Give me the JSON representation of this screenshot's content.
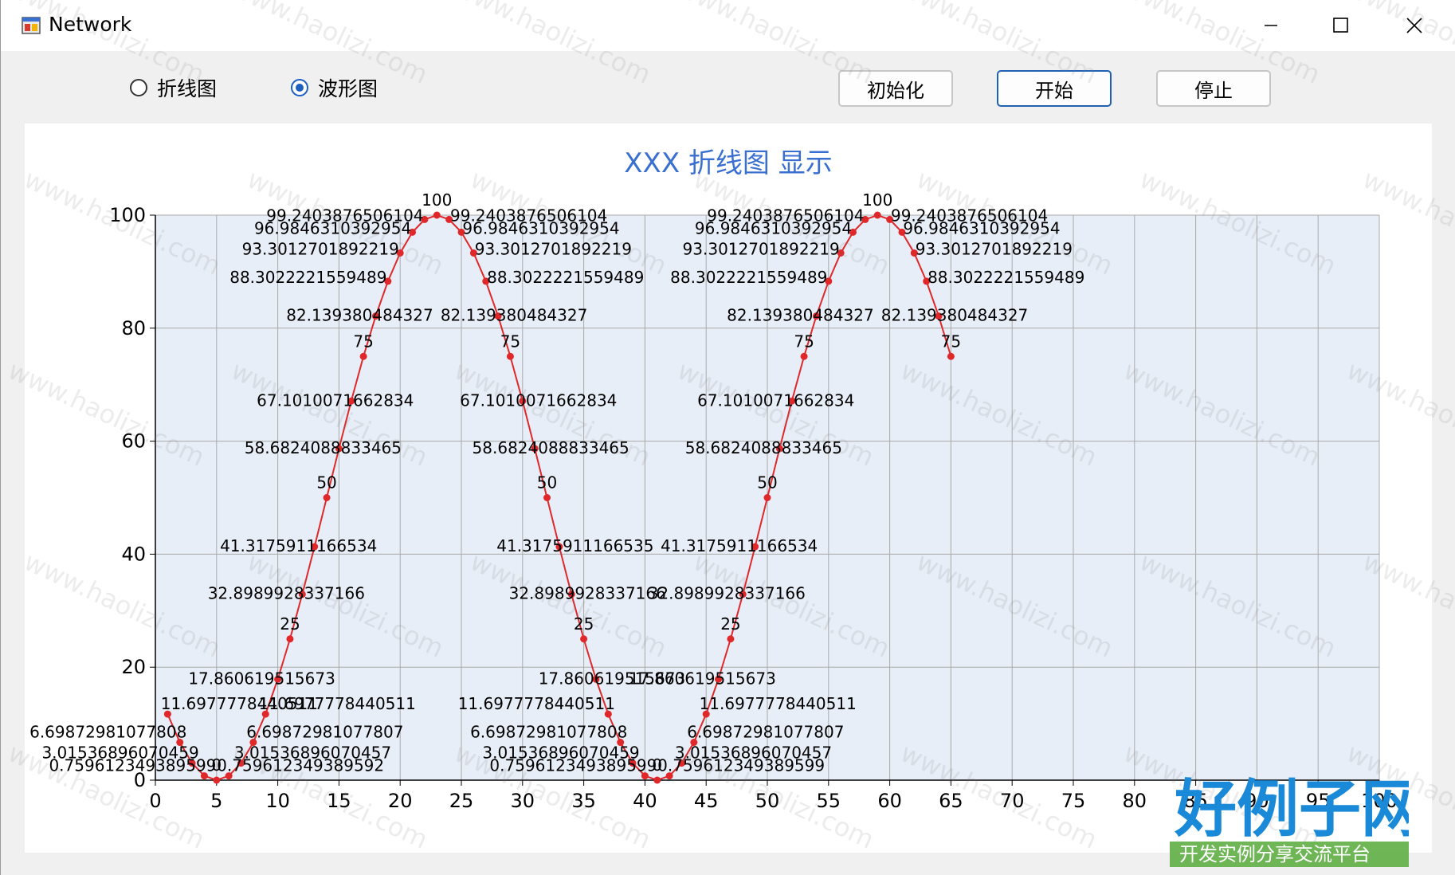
{
  "window": {
    "title": "Network",
    "controls": [
      "minimize-icon",
      "maximize-icon",
      "close-icon"
    ]
  },
  "options": [
    {
      "label": "折线图",
      "selected": false
    },
    {
      "label": "波形图",
      "selected": true
    }
  ],
  "buttons": {
    "init": "初始化",
    "start": "开始",
    "stop": "停止"
  },
  "chart_title": "XXX 折线图 显示",
  "chart_data": {
    "type": "line",
    "title": "XXX 折线图 显示",
    "xlabel": "",
    "ylabel": "",
    "xlim": [
      0,
      100
    ],
    "ylim": [
      0,
      100
    ],
    "x_ticks": [
      "0",
      "5",
      "10",
      "15",
      "20",
      "25",
      "30",
      "35",
      "40",
      "45",
      "50",
      "55",
      "60",
      "65",
      "70",
      "75",
      "80",
      "85",
      "90",
      "95",
      "100"
    ],
    "y_ticks": [
      "0",
      "20",
      "40",
      "60",
      "80",
      "100"
    ],
    "grid": true,
    "series": [
      {
        "color": "#e0282a",
        "x": [
          1,
          2,
          3,
          4,
          5,
          6,
          7,
          8,
          9,
          10,
          11,
          12,
          13,
          14,
          15,
          16,
          17,
          18,
          19,
          20,
          21,
          22,
          23,
          24,
          25,
          26,
          27,
          28,
          29,
          30,
          31,
          32,
          33,
          34,
          35,
          36,
          37,
          38,
          39,
          40,
          41,
          42,
          43,
          44,
          45,
          46,
          47,
          48,
          49,
          50,
          51,
          52,
          53,
          54,
          55,
          56,
          57,
          58,
          59,
          60,
          61,
          62,
          63,
          64,
          65
        ],
        "y": [
          11.6977778440511,
          6.69872981077808,
          3.01536896070459,
          0.759612349389599,
          0,
          0.759612349389592,
          3.01536896070457,
          6.69872981077807,
          11.6977778440511,
          17.860619515673,
          25,
          32.8989928337166,
          41.3175911166534,
          50,
          58.6824088833465,
          67.1010071662834,
          75,
          82.139380484327,
          88.3022221559489,
          93.3012701892219,
          96.9846310392954,
          99.2403876506104,
          100,
          99.2403876506104,
          96.9846310392954,
          93.3012701892219,
          88.3022221559489,
          82.139380484327,
          75,
          67.1010071662834,
          58.6824088833465,
          50,
          41.3175911166535,
          32.8989928337166,
          25,
          17.860619515673,
          11.6977778440511,
          6.69872981077808,
          3.01536896070459,
          0.759612349389599,
          0,
          0.759612349389599,
          3.01536896070457,
          6.69872981077807,
          11.6977778440511,
          17.860619515673,
          25,
          32.8989928337166,
          41.3175911166534,
          50,
          58.6824088833465,
          67.1010071662834,
          75,
          82.139380484327,
          88.3022221559489,
          93.3012701892219,
          96.9846310392954,
          99.2403876506104,
          100,
          99.2403876506104,
          96.9846310392954,
          93.3012701892219,
          88.3022221559489,
          82.139380484327,
          75
        ],
        "labels": [
          "11.6977778440511",
          "6.69872981077808",
          "3.01536896070459",
          "0.759612349389599",
          "0",
          "0.759612349389592",
          "3.01536896070457",
          "6.69872981077807",
          "11.6977778440511",
          "17.860619515673",
          "25",
          "32.8989928337166",
          "41.3175911166534",
          "50",
          "58.6824088833465",
          "67.1010071662834",
          "75",
          "82.139380484327",
          "88.3022221559489",
          "93.3012701892219",
          "96.9846310392954",
          "99.2403876506104",
          "100",
          "99.2403876506104",
          "96.9846310392954",
          "93.3012701892219",
          "88.3022221559489",
          "82.139380484327",
          "75",
          "67.1010071662834",
          "58.6824088833465",
          "50",
          "41.3175911166535",
          "32.8989928337166",
          "25",
          "17.860619515673",
          "11.6977778440511",
          "6.69872981077808",
          "3.01536896070459",
          "0.759612349389599",
          "0",
          "0.759612349389599",
          "3.01536896070457",
          "6.69872981077807",
          "11.6977778440511",
          "17.860619515673",
          "25",
          "32.8989928337166",
          "41.3175911166534",
          "50",
          "58.6824088833465",
          "67.1010071662834",
          "75",
          "82.139380484327",
          "88.3022221559489",
          "93.3012701892219",
          "96.9846310392954",
          "99.2403876506104",
          "100",
          "99.2403876506104",
          "96.9846310392954",
          "93.3012701892219",
          "88.3022221559489",
          "82.139380484327",
          "75"
        ]
      }
    ]
  },
  "watermark": "www.haolizi.com",
  "logo": {
    "main": "好例子网",
    "sub": "开发实例分享交流平台"
  }
}
